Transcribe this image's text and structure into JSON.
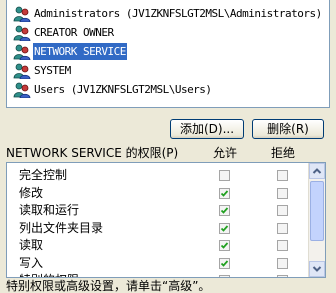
{
  "users": [
    {
      "name": "Administrators (JV1ZKNFSLGT2MSL\\Administrators)",
      "icon": "users-group-icon",
      "selected": false
    },
    {
      "name": "CREATOR OWNER",
      "icon": "users-group-icon",
      "selected": false
    },
    {
      "name": "NETWORK SERVICE",
      "icon": "users-group-icon",
      "selected": true
    },
    {
      "name": "SYSTEM",
      "icon": "users-group-icon",
      "selected": false
    },
    {
      "name": "Users (JV1ZKNFSLGT2MSL\\Users)",
      "icon": "users-group-icon",
      "selected": false
    }
  ],
  "buttons": {
    "add": "添加(D)...",
    "remove": "删除(R)"
  },
  "permissions": {
    "header_label": "NETWORK SERVICE 的权限(P)",
    "allow_label": "允许",
    "deny_label": "拒绝",
    "rows": [
      {
        "name": "完全控制",
        "allow": false,
        "deny": false
      },
      {
        "name": "修改",
        "allow": true,
        "deny": false
      },
      {
        "name": "读取和运行",
        "allow": true,
        "deny": false
      },
      {
        "name": "列出文件夹目录",
        "allow": true,
        "deny": false
      },
      {
        "name": "读取",
        "allow": true,
        "deny": false
      },
      {
        "name": "写入",
        "allow": true,
        "deny": false
      },
      {
        "name": "特别的权限",
        "allow": false,
        "deny": false
      }
    ]
  },
  "footer": {
    "text": "特别权限或高级设置，请单击“高级”。"
  },
  "colors": {
    "selection": "#316ac5",
    "check": "#21a121",
    "window_bg": "#ece9d8"
  }
}
